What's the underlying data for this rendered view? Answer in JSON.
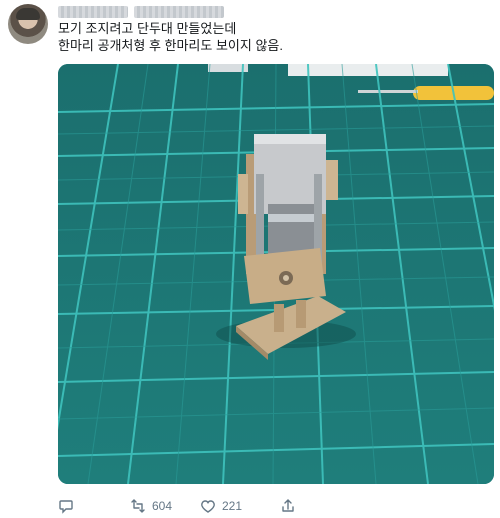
{
  "tweet": {
    "text_lines": [
      "모기 조지려고 단두대 만들었는데",
      "한마리 공개처형 후 한마리도 보이지 않음."
    ],
    "retweet_count": "604",
    "like_count": "221"
  },
  "icons": {
    "reply": "reply-icon",
    "retweet": "retweet-icon",
    "like": "heart-icon",
    "share": "share-icon"
  },
  "colors": {
    "mat": "#1f7b78",
    "grid": "#40c9c4",
    "text": "#14171a",
    "muted": "#657786"
  }
}
